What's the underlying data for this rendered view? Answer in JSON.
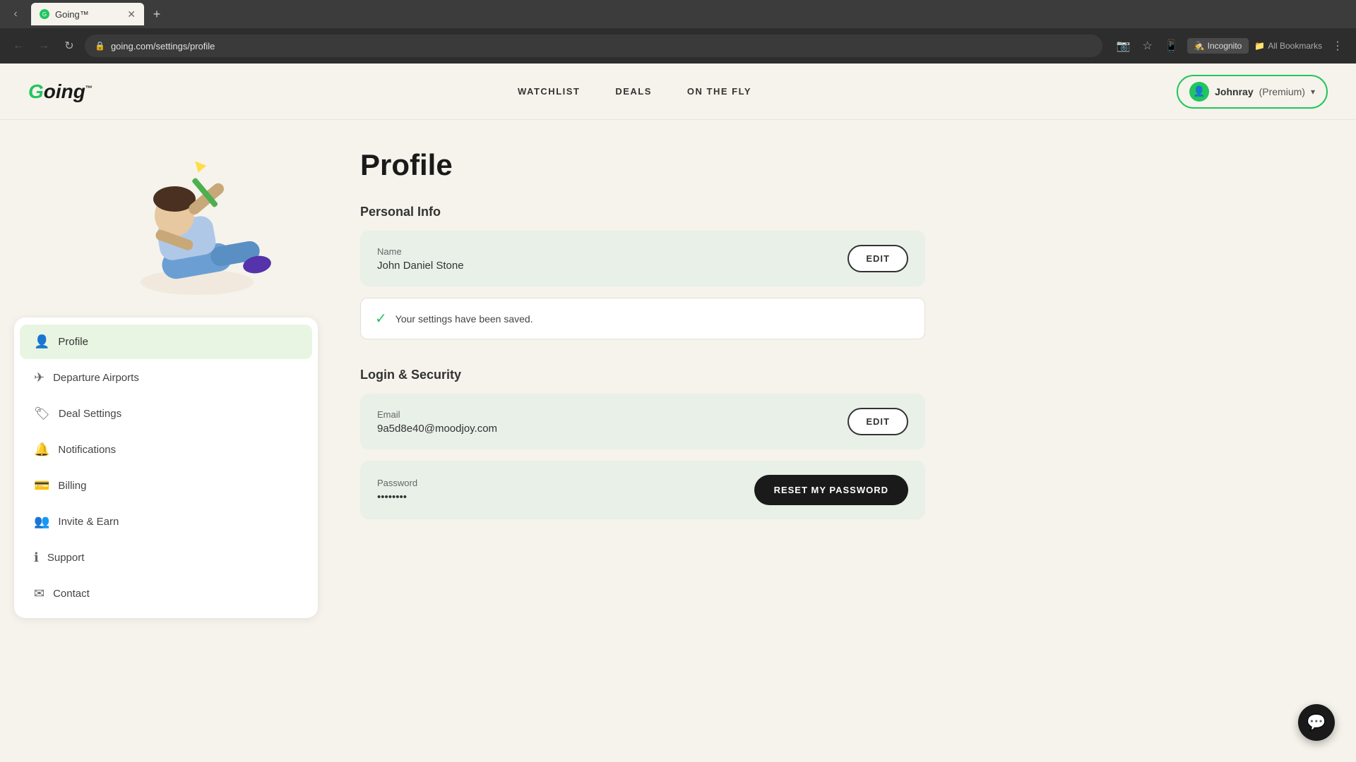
{
  "browser": {
    "tab_title": "Going™",
    "url": "going.com/settings/profile",
    "new_tab_label": "+",
    "incognito_label": "Incognito",
    "bookmarks_label": "All Bookmarks"
  },
  "header": {
    "logo": "Going",
    "logo_trademark": "™",
    "nav": {
      "watchlist": "WATCHLIST",
      "deals": "DEALS",
      "on_the_fly": "ON THE FLY"
    },
    "user": {
      "name": "Johnray",
      "plan": "(Premium)"
    }
  },
  "sidebar": {
    "items": [
      {
        "id": "profile",
        "label": "Profile",
        "active": true
      },
      {
        "id": "departure-airports",
        "label": "Departure Airports",
        "active": false
      },
      {
        "id": "deal-settings",
        "label": "Deal Settings",
        "active": false
      },
      {
        "id": "notifications",
        "label": "Notifications",
        "active": false
      },
      {
        "id": "billing",
        "label": "Billing",
        "active": false
      },
      {
        "id": "invite-earn",
        "label": "Invite & Earn",
        "active": false
      },
      {
        "id": "support",
        "label": "Support",
        "active": false
      },
      {
        "id": "contact",
        "label": "Contact",
        "active": false
      }
    ]
  },
  "profile": {
    "page_title": "Profile",
    "personal_info_title": "Personal Info",
    "name_label": "Name",
    "name_value": "John Daniel Stone",
    "edit_label": "EDIT",
    "saved_message": "Your settings have been saved.",
    "login_security_title": "Login & Security",
    "email_label": "Email",
    "email_value": "9a5d8e40@moodjoy.com",
    "edit_email_label": "EDIT",
    "password_label": "Password",
    "password_value": "••••••••",
    "reset_password_label": "RESET MY PASSWORD"
  },
  "chat_button_icon": "💬"
}
